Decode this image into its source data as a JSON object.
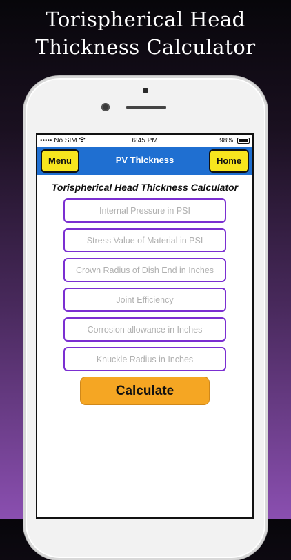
{
  "promo": {
    "title_line1": "Torispherical Head",
    "title_line2": "Thickness Calculator"
  },
  "status_bar": {
    "carrier": "No SIM",
    "time": "6:45 PM",
    "battery": "98%",
    "battery_level": 0.98
  },
  "nav": {
    "menu_label": "Menu",
    "title": "PV Thickness",
    "home_label": "Home"
  },
  "calculator": {
    "title": "Torispherical Head Thickness Calculator",
    "fields": [
      {
        "placeholder": "Internal Pressure in PSI",
        "value": ""
      },
      {
        "placeholder": "Stress Value of Material in PSI",
        "value": ""
      },
      {
        "placeholder": "Crown Radius of Dish End in Inches",
        "value": ""
      },
      {
        "placeholder": "Joint Efficiency",
        "value": ""
      },
      {
        "placeholder": "Corrosion allowance in Inches",
        "value": ""
      },
      {
        "placeholder": "Knuckle Radius in Inches",
        "value": ""
      }
    ],
    "calculate_label": "Calculate"
  },
  "colors": {
    "nav_blue": "#1f6fd1",
    "button_yellow": "#f7e51e",
    "field_border": "#7b2fd1",
    "calculate_orange": "#f5a623"
  }
}
